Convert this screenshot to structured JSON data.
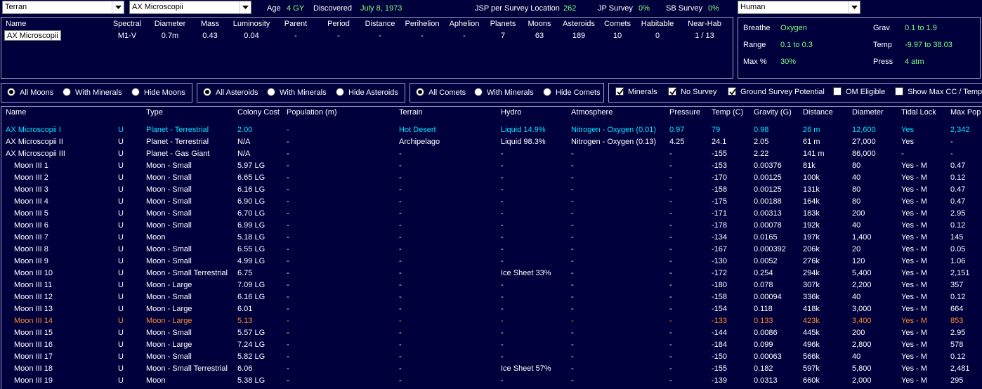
{
  "top": {
    "race_select": "Terran",
    "system_select": "AX Microscopii",
    "age_label": "Age",
    "age_value": "4 GY",
    "discovered_label": "Discovered",
    "discovered_value": "July 8, 1973",
    "jsp_label": "JSP per Survey Location",
    "jsp_value": "262",
    "jp_label": "JP Survey",
    "jp_value": "0%",
    "sb_label": "SB Survey",
    "sb_value": "0%",
    "species_select": "Human"
  },
  "summary": {
    "headers": [
      "Name",
      "Spectral",
      "Diameter",
      "Mass",
      "Luminosity",
      "Parent",
      "Period",
      "Distance",
      "Perihelion",
      "Aphelion",
      "Planets",
      "Moons",
      "Asteroids",
      "Comets",
      "Habitable",
      "Near-Hab"
    ],
    "name": "AX Microscopii",
    "values": [
      "M1-V",
      "0.7m",
      "0.43",
      "0.04",
      "-",
      "-",
      "-",
      "-",
      "-",
      "7",
      "63",
      "189",
      "10",
      "0",
      "1 / 13"
    ]
  },
  "environment": {
    "breathe_label": "Breathe",
    "breathe_value": "Oxygen",
    "range_label": "Range",
    "range_value": "0.1  to  0.3",
    "maxpct_label": "Max %",
    "maxpct_value": "30%",
    "grav_label": "Grav",
    "grav_value": "0.1  to  1.9",
    "temp_label": "Temp",
    "temp_value": "-9.97  to  38.03",
    "press_label": "Press",
    "press_value": "4 atm"
  },
  "filters": {
    "moons": [
      "All Moons",
      "With Minerals",
      "Hide Moons"
    ],
    "asteroids": [
      "All Asteroids",
      "With Minerals",
      "Hide Asteroids"
    ],
    "comets": [
      "All Comets",
      "With Minerals",
      "Hide Comets"
    ],
    "checks": [
      {
        "label": "Minerals",
        "checked": true
      },
      {
        "label": "No Survey",
        "checked": true
      },
      {
        "label": "Ground Survey Potential",
        "checked": true
      },
      {
        "label": "OM Eligible",
        "checked": false
      },
      {
        "label": "Show Max CC / Temp",
        "checked": false
      }
    ]
  },
  "table": {
    "headers": [
      "Name",
      "Type",
      "Colony Cost",
      "Population (m)",
      "Terrain",
      "Hydro",
      "Atmosphere",
      "Pressure",
      "Temp (C)",
      "Gravity (G)",
      "Distance",
      "Diameter",
      "Tidal Lock",
      "Max Pop"
    ],
    "rows": [
      {
        "name": "AX Microscopii I",
        "u": "U",
        "type": "Planet - Terrestrial",
        "cc": "2.00",
        "pop": "-",
        "terrain": "Hot Desert",
        "hydro": "Liquid 14.9%",
        "atmo": "Nitrogen - Oxygen (0.01)",
        "press": "0.97",
        "temp": "79",
        "grav": "0.98",
        "dist": "26 m",
        "diam": "12,600",
        "tidal": "Yes",
        "maxpop": "2,342",
        "style": "hl"
      },
      {
        "name": "AX Microscopii II",
        "u": "U",
        "type": "Planet - Terrestrial",
        "cc": "N/A",
        "pop": "-",
        "terrain": "Archipelago",
        "hydro": "Liquid 98.3%",
        "atmo": "Nitrogen - Oxygen (0.13)",
        "press": "4.25",
        "temp": "24.1",
        "grav": "2.05",
        "dist": "61 m",
        "diam": "27,000",
        "tidal": "Yes",
        "maxpop": "-",
        "style": ""
      },
      {
        "name": "AX Microscopii III",
        "u": "U",
        "type": "Planet - Gas Giant",
        "cc": "N/A",
        "pop": "-",
        "terrain": "-",
        "hydro": "-",
        "atmo": "-",
        "press": "-",
        "temp": "-155",
        "grav": "2.22",
        "dist": "141 m",
        "diam": "86,000",
        "tidal": "-",
        "maxpop": "-",
        "style": ""
      },
      {
        "name": "Moon III 1",
        "u": "U",
        "type": "Moon - Small",
        "cc": "5.97 LG",
        "pop": "-",
        "terrain": "-",
        "hydro": "-",
        "atmo": "-",
        "press": "-",
        "temp": "-153",
        "grav": "0.00376",
        "dist": "81k",
        "diam": "80",
        "tidal": "Yes - M",
        "maxpop": "0.47",
        "style": ""
      },
      {
        "name": "Moon III 2",
        "u": "U",
        "type": "Moon - Small",
        "cc": "6.65 LG",
        "pop": "-",
        "terrain": "-",
        "hydro": "-",
        "atmo": "-",
        "press": "-",
        "temp": "-170",
        "grav": "0.00125",
        "dist": "100k",
        "diam": "40",
        "tidal": "Yes - M",
        "maxpop": "0.12",
        "style": ""
      },
      {
        "name": "Moon III 3",
        "u": "U",
        "type": "Moon - Small",
        "cc": "6.16 LG",
        "pop": "-",
        "terrain": "-",
        "hydro": "-",
        "atmo": "-",
        "press": "-",
        "temp": "-158",
        "grav": "0.00125",
        "dist": "131k",
        "diam": "80",
        "tidal": "Yes - M",
        "maxpop": "0.47",
        "style": ""
      },
      {
        "name": "Moon III 4",
        "u": "U",
        "type": "Moon - Small",
        "cc": "6.90 LG",
        "pop": "-",
        "terrain": "-",
        "hydro": "-",
        "atmo": "-",
        "press": "-",
        "temp": "-175",
        "grav": "0.00188",
        "dist": "164k",
        "diam": "80",
        "tidal": "Yes - M",
        "maxpop": "0.47",
        "style": ""
      },
      {
        "name": "Moon III 5",
        "u": "U",
        "type": "Moon - Small",
        "cc": "6.70 LG",
        "pop": "-",
        "terrain": "-",
        "hydro": "-",
        "atmo": "-",
        "press": "-",
        "temp": "-171",
        "grav": "0.00313",
        "dist": "183k",
        "diam": "200",
        "tidal": "Yes - M",
        "maxpop": "2.95",
        "style": ""
      },
      {
        "name": "Moon III 6",
        "u": "U",
        "type": "Moon - Small",
        "cc": "6.99 LG",
        "pop": "-",
        "terrain": "-",
        "hydro": "-",
        "atmo": "-",
        "press": "-",
        "temp": "-178",
        "grav": "0.00078",
        "dist": "192k",
        "diam": "40",
        "tidal": "Yes - M",
        "maxpop": "0.12",
        "style": ""
      },
      {
        "name": "Moon III 7",
        "u": "U",
        "type": "Moon",
        "cc": "5.18 LG",
        "pop": "-",
        "terrain": "-",
        "hydro": "-",
        "atmo": "-",
        "press": "-",
        "temp": "-134",
        "grav": "0.0165",
        "dist": "197k",
        "diam": "1,400",
        "tidal": "Yes - M",
        "maxpop": "145",
        "style": ""
      },
      {
        "name": "Moon III 8",
        "u": "U",
        "type": "Moon - Small",
        "cc": "6.55 LG",
        "pop": "-",
        "terrain": "-",
        "hydro": "-",
        "atmo": "-",
        "press": "-",
        "temp": "-167",
        "grav": "0.000392",
        "dist": "206k",
        "diam": "20",
        "tidal": "Yes - M",
        "maxpop": "0.05",
        "style": ""
      },
      {
        "name": "Moon III 9",
        "u": "U",
        "type": "Moon - Small",
        "cc": "4.99 LG",
        "pop": "-",
        "terrain": "-",
        "hydro": "-",
        "atmo": "-",
        "press": "-",
        "temp": "-130",
        "grav": "0.0052",
        "dist": "276k",
        "diam": "120",
        "tidal": "Yes - M",
        "maxpop": "1.06",
        "style": ""
      },
      {
        "name": "Moon III 10",
        "u": "U",
        "type": "Moon - Small Terrestrial",
        "cc": "6.75",
        "pop": "-",
        "terrain": "-",
        "hydro": "Ice Sheet 33%",
        "atmo": "-",
        "press": "-",
        "temp": "-172",
        "grav": "0.254",
        "dist": "294k",
        "diam": "5,400",
        "tidal": "Yes - M",
        "maxpop": "2,151",
        "style": ""
      },
      {
        "name": "Moon III 11",
        "u": "U",
        "type": "Moon - Large",
        "cc": "7.09 LG",
        "pop": "-",
        "terrain": "-",
        "hydro": "-",
        "atmo": "-",
        "press": "-",
        "temp": "-180",
        "grav": "0.078",
        "dist": "307k",
        "diam": "2,200",
        "tidal": "Yes - M",
        "maxpop": "357",
        "style": ""
      },
      {
        "name": "Moon III 12",
        "u": "U",
        "type": "Moon - Small",
        "cc": "6.16 LG",
        "pop": "-",
        "terrain": "-",
        "hydro": "-",
        "atmo": "-",
        "press": "-",
        "temp": "-158",
        "grav": "0.00094",
        "dist": "336k",
        "diam": "40",
        "tidal": "Yes - M",
        "maxpop": "0.12",
        "style": ""
      },
      {
        "name": "Moon III 13",
        "u": "U",
        "type": "Moon - Large",
        "cc": "6.01",
        "pop": "-",
        "terrain": "-",
        "hydro": "-",
        "atmo": "-",
        "press": "-",
        "temp": "-154",
        "grav": "0.118",
        "dist": "418k",
        "diam": "3,000",
        "tidal": "Yes - M",
        "maxpop": "664",
        "style": ""
      },
      {
        "name": "Moon III 14",
        "u": "U",
        "type": "Moon - Large",
        "cc": "5.13",
        "pop": "-",
        "terrain": "-",
        "hydro": "-",
        "atmo": "-",
        "press": "-",
        "temp": "-133",
        "grav": "0.133",
        "dist": "423k",
        "diam": "3,400",
        "tidal": "Yes - M",
        "maxpop": "853",
        "style": "sel2"
      },
      {
        "name": "Moon III 15",
        "u": "U",
        "type": "Moon - Small",
        "cc": "5.57 LG",
        "pop": "-",
        "terrain": "-",
        "hydro": "-",
        "atmo": "-",
        "press": "-",
        "temp": "-144",
        "grav": "0.0086",
        "dist": "445k",
        "diam": "200",
        "tidal": "Yes - M",
        "maxpop": "2.95",
        "style": ""
      },
      {
        "name": "Moon III 16",
        "u": "U",
        "type": "Moon - Large",
        "cc": "7.24 LG",
        "pop": "-",
        "terrain": "-",
        "hydro": "-",
        "atmo": "-",
        "press": "-",
        "temp": "-184",
        "grav": "0.099",
        "dist": "496k",
        "diam": "2,800",
        "tidal": "Yes - M",
        "maxpop": "578",
        "style": ""
      },
      {
        "name": "Moon III 17",
        "u": "U",
        "type": "Moon - Small",
        "cc": "5.82 LG",
        "pop": "-",
        "terrain": "-",
        "hydro": "-",
        "atmo": "-",
        "press": "-",
        "temp": "-150",
        "grav": "0.00063",
        "dist": "566k",
        "diam": "40",
        "tidal": "Yes - M",
        "maxpop": "0.12",
        "style": ""
      },
      {
        "name": "Moon III 18",
        "u": "U",
        "type": "Moon - Small Terrestrial",
        "cc": "6.06",
        "pop": "-",
        "terrain": "-",
        "hydro": "Ice Sheet 57%",
        "atmo": "-",
        "press": "-",
        "temp": "-155",
        "grav": "0.182",
        "dist": "597k",
        "diam": "5,800",
        "tidal": "Yes - M",
        "maxpop": "2,481",
        "style": ""
      },
      {
        "name": "Moon III 19",
        "u": "U",
        "type": "Moon",
        "cc": "5.38 LG",
        "pop": "-",
        "terrain": "-",
        "hydro": "-",
        "atmo": "-",
        "press": "-",
        "temp": "-139",
        "grav": "0.0313",
        "dist": "660k",
        "diam": "2,000",
        "tidal": "Yes - M",
        "maxpop": "295",
        "style": ""
      }
    ]
  }
}
